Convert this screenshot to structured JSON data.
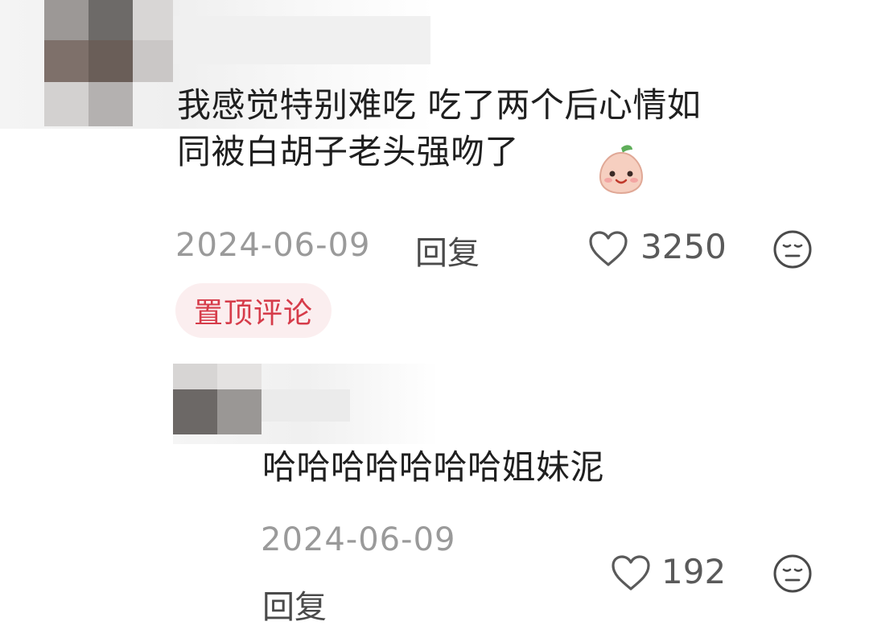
{
  "comment": {
    "text_line1": "我感觉特别难吃 吃了两个后心情如",
    "text_line2": "同被白胡子老头强吻了",
    "emoji_icon": "peach-face-emoji-icon",
    "date": "2024-06-09",
    "reply_label": "回复",
    "like_count": "3250",
    "like_icon": "heart-outline-icon",
    "dislike_icon": "neutral-face-icon",
    "badge": "置顶评论"
  },
  "reply": {
    "text": "哈哈哈哈哈哈哈姐妹泥",
    "date": "2024-06-09",
    "reply_label": "回复",
    "like_count": "192",
    "like_icon": "heart-outline-icon",
    "dislike_icon": "neutral-face-icon"
  },
  "colors": {
    "badge_bg": "#fbeeef",
    "badge_text": "#d63c4a",
    "meta_gray": "#9a9a9a"
  }
}
